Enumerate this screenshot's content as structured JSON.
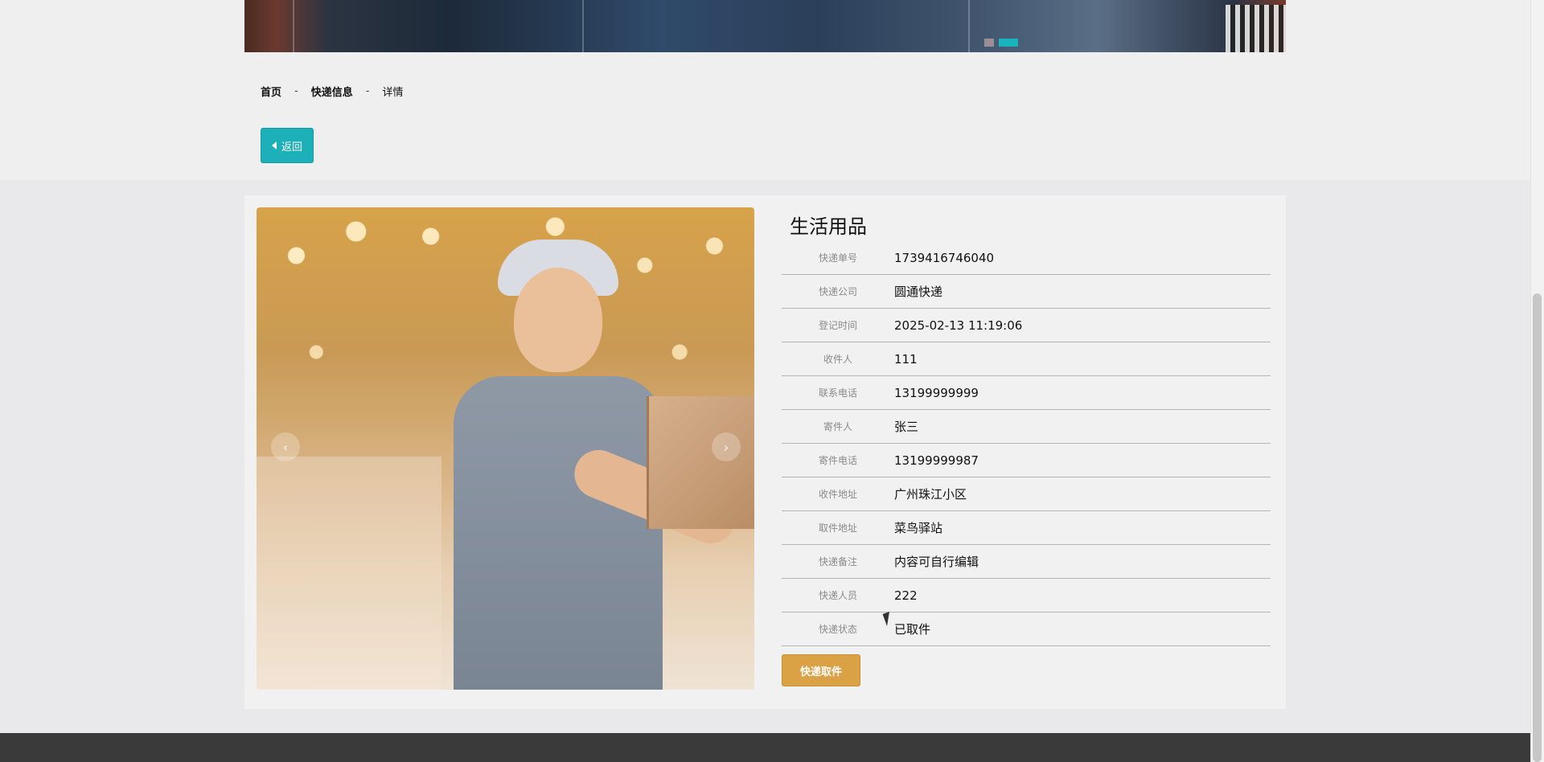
{
  "breadcrumb": {
    "home": "首页",
    "section": "快递信息",
    "current": "详情",
    "separator": "-"
  },
  "actions": {
    "back_label": "返回",
    "pickup_label": "快递取件"
  },
  "product": {
    "title": "生活用品"
  },
  "details": [
    {
      "label": "快递单号",
      "value": "1739416746040"
    },
    {
      "label": "快递公司",
      "value": "圆通快递"
    },
    {
      "label": "登记时间",
      "value": "2025-02-13 11:19:06"
    },
    {
      "label": "收件人",
      "value": "111"
    },
    {
      "label": "联系电话",
      "value": "13199999999"
    },
    {
      "label": "寄件人",
      "value": "张三"
    },
    {
      "label": "寄件电话",
      "value": "13199999987"
    },
    {
      "label": "收件地址",
      "value": "广州珠江小区"
    },
    {
      "label": "取件地址",
      "value": "菜鸟驿站"
    },
    {
      "label": "快递备注",
      "value": "内容可自行编辑"
    },
    {
      "label": "快递人员",
      "value": "222"
    },
    {
      "label": "快递状态",
      "value": "已取件"
    }
  ],
  "banner": {
    "dots_count": 2,
    "active_dot": 1
  },
  "colors": {
    "accent": "#1db0b9",
    "pickup": "#dba145"
  }
}
